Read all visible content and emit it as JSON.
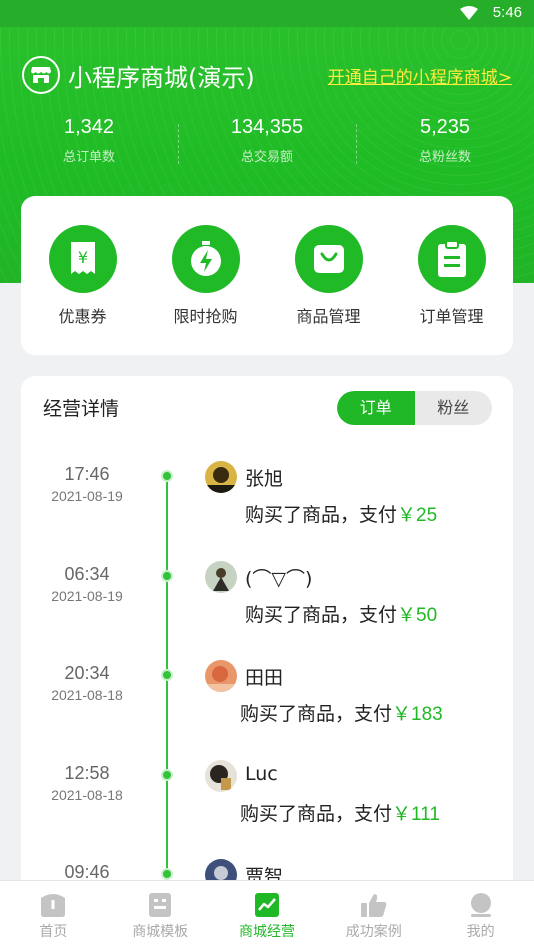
{
  "status_bar": {
    "time": "5:46"
  },
  "header": {
    "shop_name": "小程序商城(演示)",
    "open_link": "开通自己的小程序商城>"
  },
  "stats": [
    {
      "value": "1,342",
      "label": "总订单数"
    },
    {
      "value": "134,355",
      "label": "总交易额"
    },
    {
      "value": "5,235",
      "label": "总粉丝数"
    }
  ],
  "quick_actions": [
    {
      "label": "优惠券",
      "icon": "coupon-icon"
    },
    {
      "label": "限时抢购",
      "icon": "flash-sale-icon"
    },
    {
      "label": "商品管理",
      "icon": "shopping-bag-icon"
    },
    {
      "label": "订单管理",
      "icon": "clipboard-icon"
    }
  ],
  "detail": {
    "title": "经营详情",
    "segments": [
      "订单",
      "粉丝"
    ],
    "entries": [
      {
        "time": "17:46",
        "date": "2021-08-19",
        "name": "张旭",
        "action": "购买了商品，支付",
        "amount": "￥25"
      },
      {
        "time": "06:34",
        "date": "2021-08-19",
        "name": "(⌒▽⌒)",
        "action": "购买了商品，支付",
        "amount": "￥50"
      },
      {
        "time": "20:34",
        "date": "2021-08-18",
        "name": "田田",
        "action": "购买了商品，支付",
        "amount": "￥183"
      },
      {
        "time": "12:58",
        "date": "2021-08-18",
        "name": "Luc",
        "action": "购买了商品，支付",
        "amount": "￥111"
      },
      {
        "time": "09:46",
        "date": "",
        "name": "贾智",
        "action": "",
        "amount": ""
      }
    ]
  },
  "tabbar": [
    {
      "label": "首页",
      "icon": "home-icon"
    },
    {
      "label": "商城模板",
      "icon": "template-icon"
    },
    {
      "label": "商城经营",
      "icon": "trend-chart-icon",
      "active": true
    },
    {
      "label": "成功案例",
      "icon": "thumbs-up-icon"
    },
    {
      "label": "我的",
      "icon": "profile-icon"
    }
  ],
  "colors": {
    "brand_green": "#21b827",
    "link_yellow": "#ffec3d"
  }
}
